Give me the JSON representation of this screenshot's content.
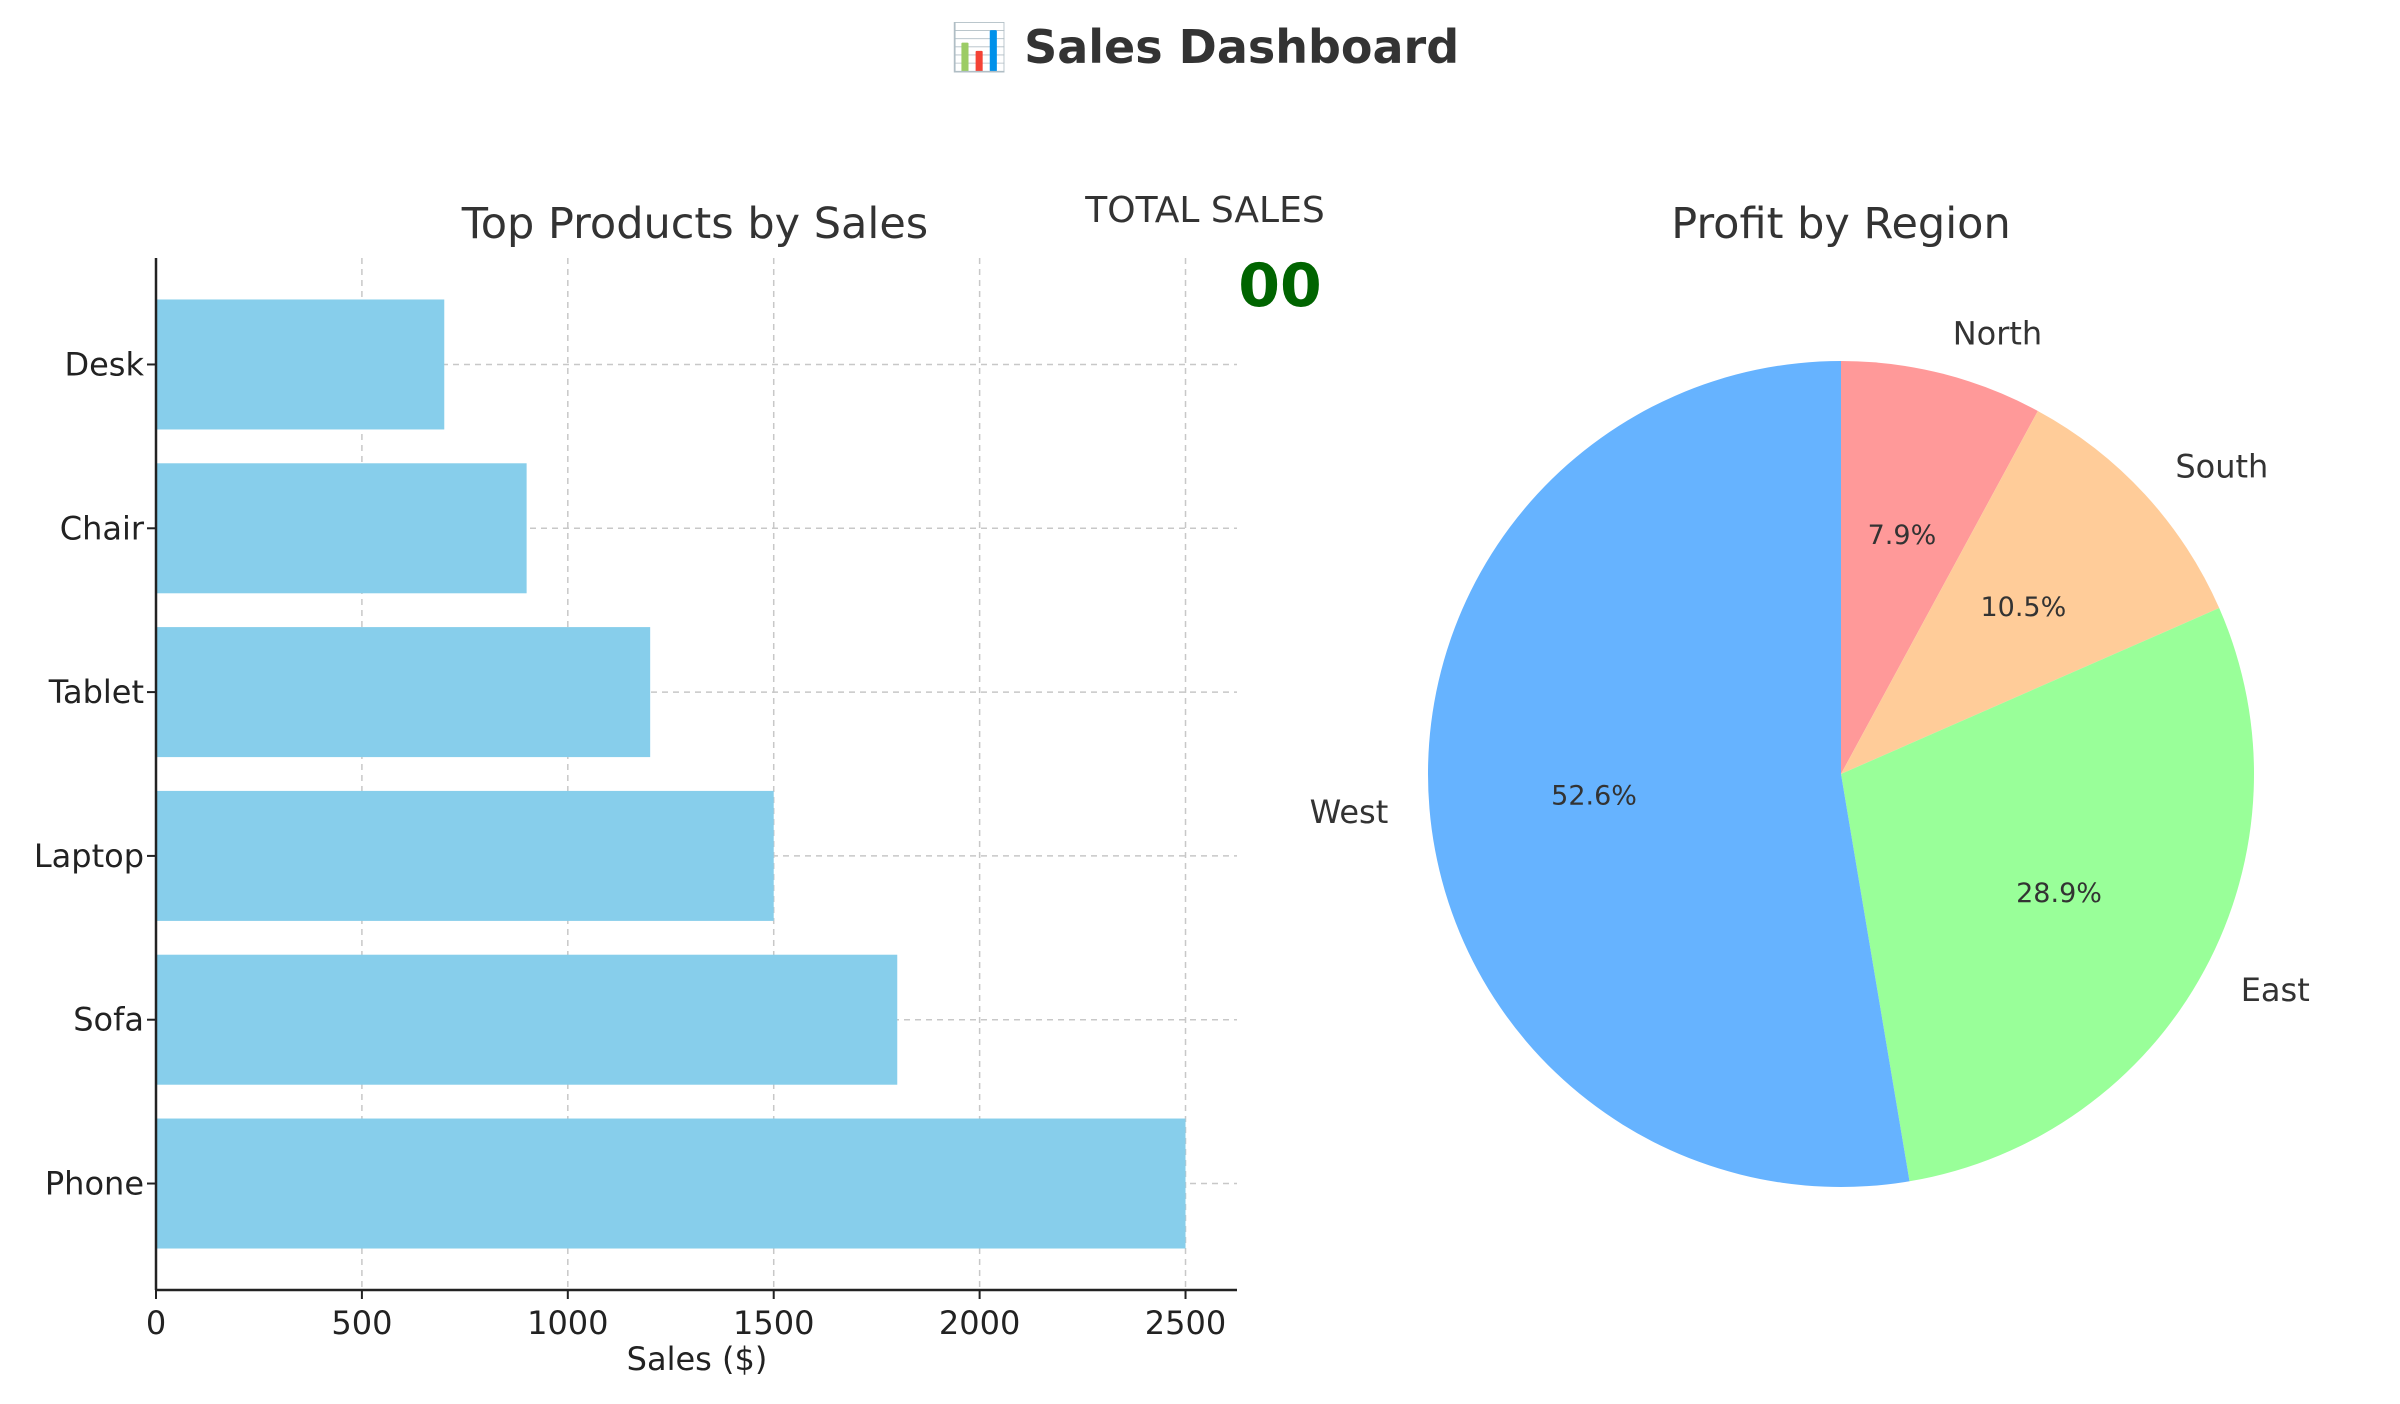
{
  "dashboard": {
    "title": "📊 Sales Dashboard"
  },
  "kpi": {
    "label": "TOTAL SALES",
    "value": "00",
    "value_color": "#006400"
  },
  "chart_data": [
    {
      "type": "bar",
      "orientation": "horizontal",
      "title": "Top Products by Sales",
      "xlabel": "Sales ($)",
      "ylabel": "",
      "categories": [
        "Phone",
        "Sofa",
        "Laptop",
        "Tablet",
        "Chair",
        "Desk"
      ],
      "values": [
        2500,
        1800,
        1500,
        1200,
        900,
        700
      ],
      "xlim": [
        0,
        2625
      ],
      "xticks": [
        0,
        500,
        1000,
        1500,
        2000,
        2500
      ],
      "grid": true,
      "bar_color": "#87CEEB"
    },
    {
      "type": "pie",
      "title": "Profit by Region",
      "labels": [
        "North",
        "South",
        "East",
        "West"
      ],
      "values": [
        7.9,
        10.5,
        28.9,
        52.6
      ],
      "percent_labels": [
        "7.9%",
        "10.5%",
        "28.9%",
        "52.6%"
      ],
      "colors": [
        "#FF9999",
        "#FFCC99",
        "#99FF99",
        "#66B3FF"
      ],
      "start_angle_deg": 90,
      "direction": "clockwise"
    }
  ]
}
